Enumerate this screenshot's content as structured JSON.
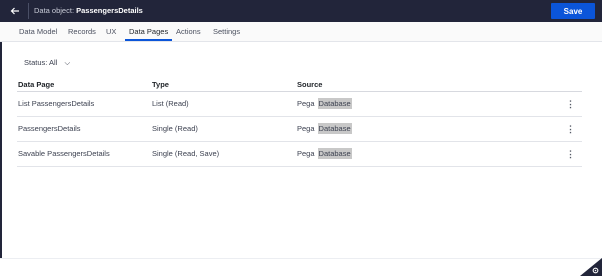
{
  "header": {
    "back_icon": "arrow-left-icon",
    "title_prefix": "Data object:",
    "title_name": "PassengersDetails",
    "save_label": "Save"
  },
  "tabs": [
    {
      "label": "Data Model",
      "active": false
    },
    {
      "label": "Records",
      "active": false
    },
    {
      "label": "UX",
      "active": false
    },
    {
      "label": "Data Pages",
      "active": true
    },
    {
      "label": "Actions",
      "active": false
    },
    {
      "label": "Settings",
      "active": false
    }
  ],
  "filter": {
    "label": "Status:",
    "value": "All",
    "chevron": "⌵"
  },
  "table": {
    "headers": {
      "page": "Data Page",
      "type": "Type",
      "source": "Source"
    },
    "rows": [
      {
        "page": "List PassengersDetails",
        "type": "List (Read)",
        "source_system": "Pega",
        "source_kind": "Database"
      },
      {
        "page": "PassengersDetails",
        "type": "Single (Read)",
        "source_system": "Pega",
        "source_kind": "Database"
      },
      {
        "page": "Savable PassengersDetails",
        "type": "Single (Read, Save)",
        "source_system": "Pega",
        "source_kind": "Database"
      }
    ],
    "row_menu_glyph": "⋮"
  },
  "colors": {
    "header_bg": "#22253a",
    "accent": "#0b55d9",
    "highlight": "#c8c8c8"
  }
}
